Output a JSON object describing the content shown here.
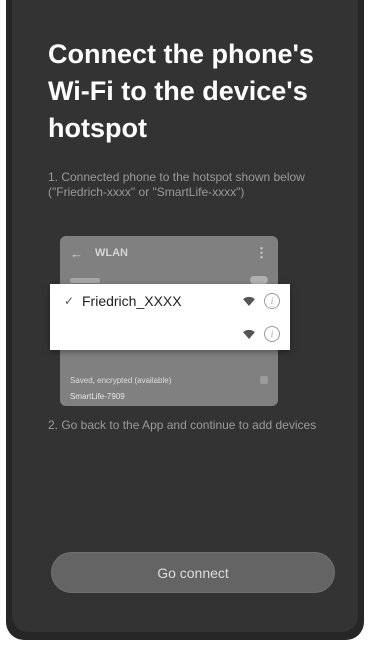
{
  "title": "Connect the phone's Wi-Fi to the device's hotspot",
  "steps": {
    "step1": "1. Connected phone to the hotspot shown below (\"Friedrich-xxxx\" or \"SmartLife-xxxx\")",
    "step2": "2. Go back to the App and continue to add devices"
  },
  "wlan_screen": {
    "header": "WLAN",
    "back_icon": "arrow-left-icon",
    "menu_icon": "more-vertical-icon",
    "network_status": "Saved, encrypted (available)",
    "network_name": "SmartLife-7909"
  },
  "popup": {
    "selected_ssid": "Friedrich_XXXX",
    "second_ssid": "",
    "check_icon": "check-icon",
    "wifi_icon": "wifi-icon",
    "info_icon": "info-icon"
  },
  "actions": {
    "go_connect": "Go connect"
  },
  "colors": {
    "background": "#333333",
    "button": "#646464",
    "text_primary": "#ffffff",
    "text_secondary": "#9a9a9a"
  }
}
